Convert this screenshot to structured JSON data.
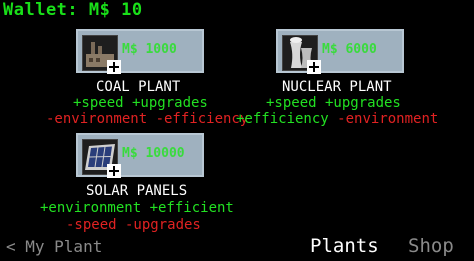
{
  "wallet": {
    "label": "Wallet: M$ 10"
  },
  "items": [
    {
      "icon": "coal-plant-icon",
      "price": "M$ 1000",
      "name": "COAL PLANT",
      "pros": "+speed +upgrades",
      "cons": "-environment -efficiency"
    },
    {
      "icon": "nuclear-plant-icon",
      "price": "M$ 6000",
      "name": "NUCLEAR PLANT",
      "pros": "+speed +upgrades",
      "extra_pro": "+efficiency",
      "extra_con": "-environment"
    },
    {
      "icon": "solar-panel-icon",
      "price": "M$ 10000",
      "name": "SOLAR PANELS",
      "pros": "+environment +efficient",
      "cons": "-speed -upgrades"
    }
  ],
  "nav": {
    "back": "< My Plant",
    "plants": "Plants",
    "shop": "Shop"
  },
  "colors": {
    "positive": "#22e022",
    "negative": "#e02222",
    "tile": "#9fb1bf",
    "wallet": "#19e019"
  }
}
